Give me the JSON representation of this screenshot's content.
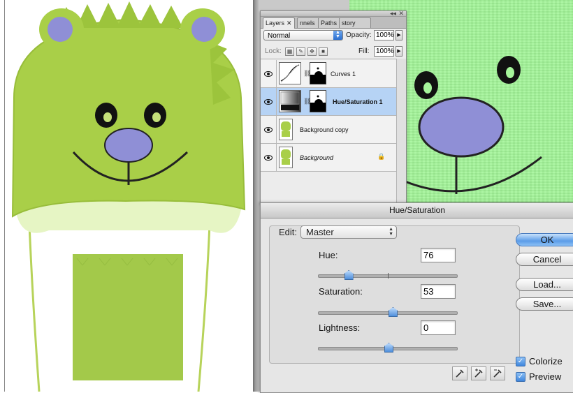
{
  "layers_panel": {
    "tabs": [
      {
        "label": "Layers",
        "close": "✕"
      },
      {
        "label": "nnels"
      },
      {
        "label": "Paths"
      },
      {
        "label": "story"
      }
    ],
    "blend_mode": "Normal",
    "opacity_label": "Opacity:",
    "opacity_value": "100%",
    "lock_label": "Lock:",
    "fill_label": "Fill:",
    "fill_value": "100%",
    "layers": [
      {
        "name": "Curves 1"
      },
      {
        "name": "Hue/Saturation 1"
      },
      {
        "name": "Background copy"
      },
      {
        "name": "Background"
      }
    ]
  },
  "dialog": {
    "title": "Hue/Saturation",
    "edit_label": "Edit:",
    "edit_value": "Master",
    "hue_label": "Hue:",
    "hue_value": "76",
    "hue_position": 0.21,
    "saturation_label": "Saturation:",
    "saturation_value": "53",
    "saturation_position": 0.53,
    "lightness_label": "Lightness:",
    "lightness_value": "0",
    "lightness_position": 0.5,
    "ok_label": "OK",
    "cancel_label": "Cancel",
    "load_label": "Load...",
    "save_label": "Save...",
    "colorize_label": "Colorize",
    "colorize_checked": true,
    "preview_label": "Preview",
    "preview_checked": true
  },
  "colors": {
    "hat_green": "#a9cf48",
    "zoom_green": "#a6f59b",
    "nose_purple": "#8f8fd6",
    "selection_blue": "#b6d3f5"
  }
}
